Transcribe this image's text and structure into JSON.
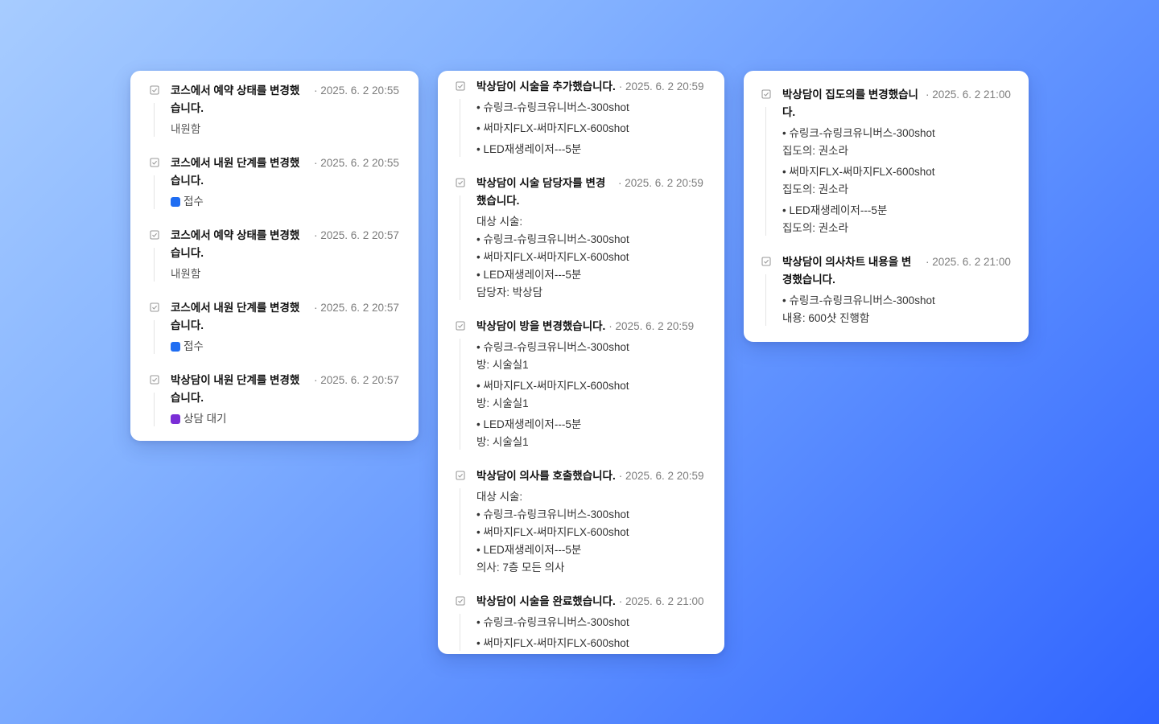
{
  "colors": {
    "reception": "#1f6df2",
    "consult_wait": "#7a2ed6"
  },
  "col1": {
    "entries": [
      {
        "title": "코스에서 예약 상태를 변경했습니다.",
        "time": "· 2025. 6. 2 20:55",
        "text": "내원함"
      },
      {
        "title": "코스에서 내원 단계를 변경했습니다.",
        "time": "· 2025. 6. 2 20:55",
        "status": "접수"
      },
      {
        "title": "코스에서 예약 상태를 변경했습니다.",
        "time": "· 2025. 6. 2 20:57",
        "text": "내원함"
      },
      {
        "title": "코스에서 내원 단계를 변경했습니다.",
        "time": "· 2025. 6. 2 20:57",
        "status": "접수"
      },
      {
        "title": "박상담이 내원 단계를 변경했습니다.",
        "time": "· 2025. 6. 2 20:57",
        "status": "상담 대기"
      }
    ]
  },
  "col2": {
    "entries": [
      {
        "title": "박상담이 시술을 추가했습니다.",
        "time": "· 2025. 6. 2 20:59",
        "items": [
          "• 슈링크-슈링크유니버스-300shot",
          "• 써마지FLX-써마지FLX-600shot",
          "• LED재생레이저---5분"
        ]
      },
      {
        "title": "박상담이 시술 담당자를 변경했습니다.",
        "time": "· 2025. 6. 2 20:59",
        "label": "대상 시술:",
        "items": [
          "• 슈링크-슈링크유니버스-300shot",
          "• 써마지FLX-써마지FLX-600shot",
          "• LED재생레이저---5분"
        ],
        "footer": "담당자: 박상담"
      },
      {
        "title": "박상담이 방을 변경했습니다.",
        "time": "· 2025. 6. 2 20:59",
        "pairs": [
          {
            "item": "• 슈링크-슈링크유니버스-300shot",
            "detail": "방: 시술실1"
          },
          {
            "item": "• 써마지FLX-써마지FLX-600shot",
            "detail": "방: 시술실1"
          },
          {
            "item": "• LED재생레이저---5분",
            "detail": "방: 시술실1"
          }
        ]
      },
      {
        "title": "박상담이 의사를 호출했습니다.",
        "time": "· 2025. 6. 2 20:59",
        "label": "대상 시술:",
        "items": [
          "• 슈링크-슈링크유니버스-300shot",
          "• 써마지FLX-써마지FLX-600shot",
          "• LED재생레이저---5분"
        ],
        "footer": "의사: 7층 모든 의사"
      },
      {
        "title": "박상담이 시술을 완료했습니다.",
        "time": "· 2025. 6. 2 21:00",
        "items": [
          "• 슈링크-슈링크유니버스-300shot",
          "• 써마지FLX-써마지FLX-600shot"
        ]
      }
    ]
  },
  "col3": {
    "entries": [
      {
        "title": "박상담이 집도의를 변경했습니다.",
        "time": "· 2025. 6. 2 21:00",
        "pairs": [
          {
            "item": "• 슈링크-슈링크유니버스-300shot",
            "detail": "집도의: 권소라"
          },
          {
            "item": "• 써마지FLX-써마지FLX-600shot",
            "detail": "집도의: 권소라"
          },
          {
            "item": "• LED재생레이저---5분",
            "detail": "집도의: 권소라"
          }
        ]
      },
      {
        "title": "박상담이 의사차트 내용을 변경했습니다.",
        "time": "· 2025. 6. 2 21:00",
        "pairs": [
          {
            "item": "• 슈링크-슈링크유니버스-300shot",
            "detail": "내용: 600샷 진행함"
          }
        ]
      }
    ]
  }
}
